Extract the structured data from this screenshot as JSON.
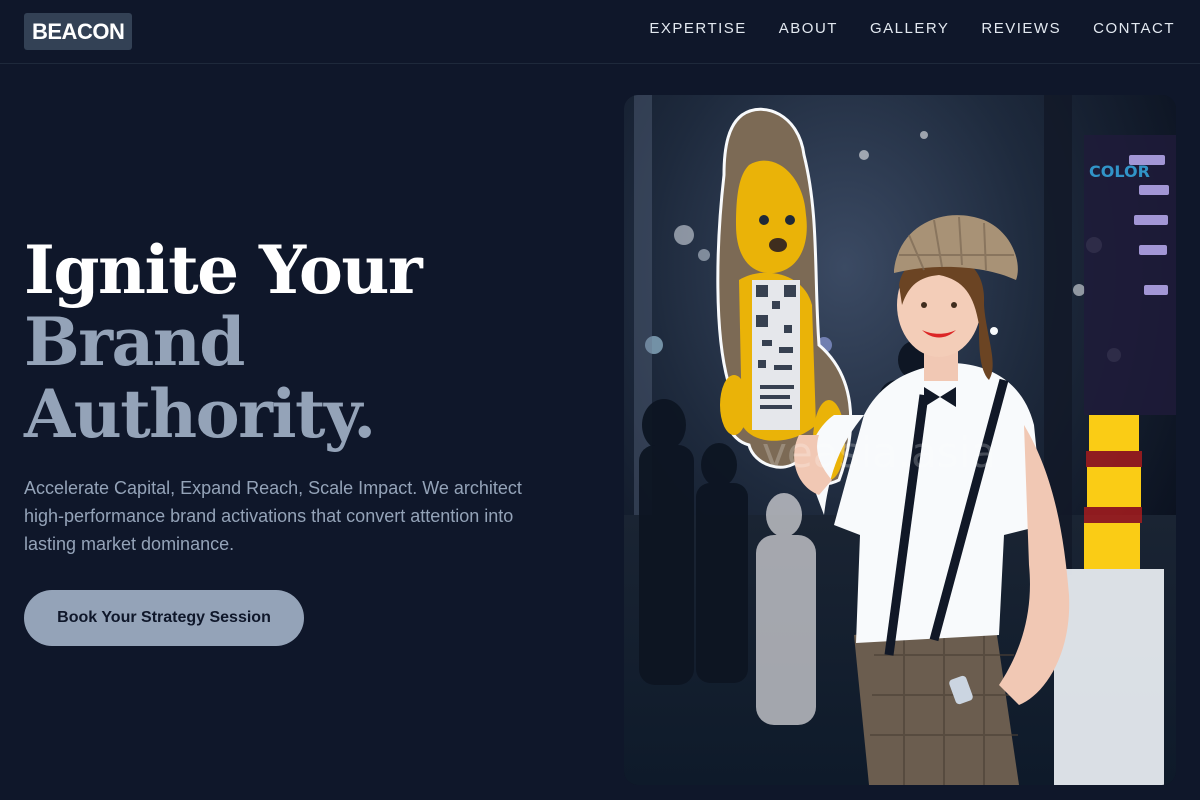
{
  "brand": {
    "logo": "BEACON"
  },
  "nav": {
    "items": [
      {
        "label": "EXPERTISE"
      },
      {
        "label": "ABOUT"
      },
      {
        "label": "GALLERY"
      },
      {
        "label": "REVIEWS"
      },
      {
        "label": "CONTACT"
      }
    ]
  },
  "hero": {
    "title_line1": "Ignite Your",
    "title_line2": "Brand",
    "title_line3": "Authority.",
    "subtitle": "Accelerate Capital, Expand Reach, Scale Impact. We architect high-performance brand activations that convert attention into lasting market dominance.",
    "cta_label": "Book Your Strategy Session"
  },
  "photo": {
    "watermark": "veasia.asia"
  },
  "colors": {
    "background": "#0f172a",
    "accent": "#94a3b8",
    "logo_bg": "#334155"
  }
}
